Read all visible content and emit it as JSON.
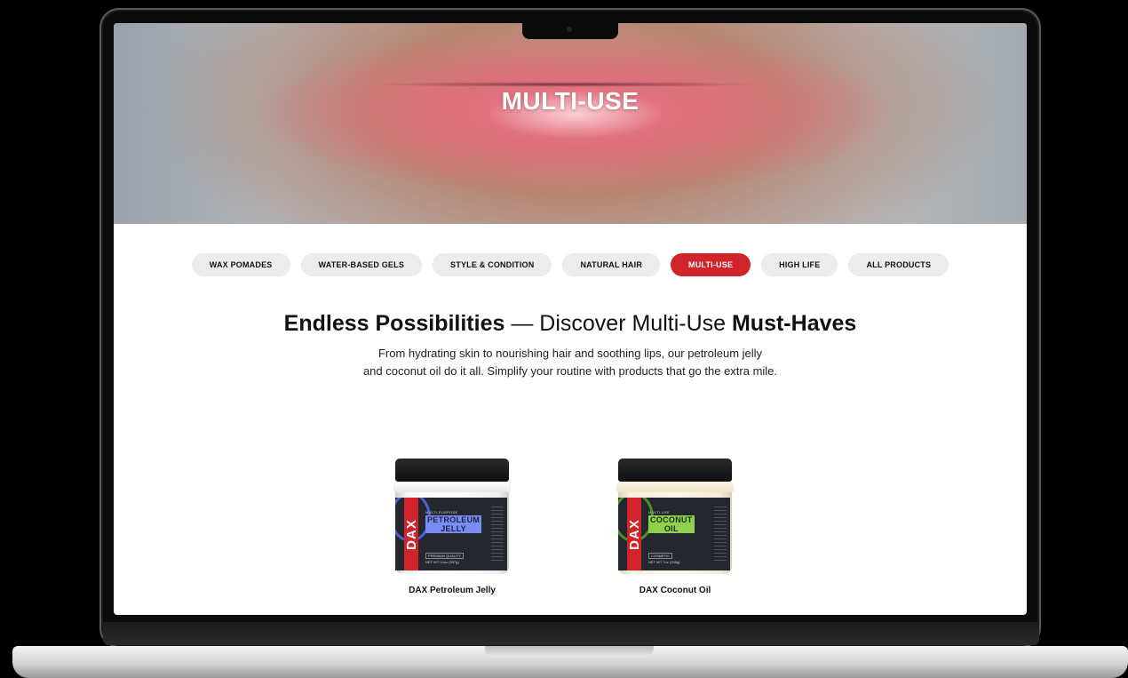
{
  "hero": {
    "title": "MULTI-USE"
  },
  "categories": [
    {
      "label": "WAX POMADES",
      "active": false
    },
    {
      "label": "WATER-BASED GELS",
      "active": false
    },
    {
      "label": "STYLE & CONDITION",
      "active": false
    },
    {
      "label": "NATURAL HAIR",
      "active": false
    },
    {
      "label": "MULTI-USE",
      "active": true
    },
    {
      "label": "HIGH LIFE",
      "active": false
    },
    {
      "label": "ALL PRODUCTS",
      "active": false
    }
  ],
  "headline": {
    "bold1": "Endless Possibilities",
    "light": " — Discover Multi-Use ",
    "bold2": "Must-Haves"
  },
  "subtext": {
    "line1": "From hydrating skin to nourishing hair and soothing lips, our petroleum jelly",
    "line2": "and coconut oil do it all. Simplify your routine with products that go the extra mile."
  },
  "products": [
    {
      "name": "DAX Petroleum Jelly",
      "label_top": "MULTI-PURPOSE",
      "label_line1": "PETROLEUM",
      "label_line2": "JELLY",
      "label_mini": "PREMIUM QUALITY",
      "label_weight": "NET WT 14oz (397g)",
      "brand": "DAX",
      "accent": "#7a8cf5"
    },
    {
      "name": "DAX Coconut Oil",
      "label_top": "MULTI-USE",
      "label_line1": "COCONUT",
      "label_line2": "OIL",
      "label_mini": "COSMETIC",
      "label_weight": "NET WT 7oz (198g)",
      "brand": "DAX",
      "accent": "#8fd14f"
    }
  ],
  "colors": {
    "active_pill": "#d2232a",
    "inactive_pill": "#ececec",
    "text": "#111111"
  }
}
